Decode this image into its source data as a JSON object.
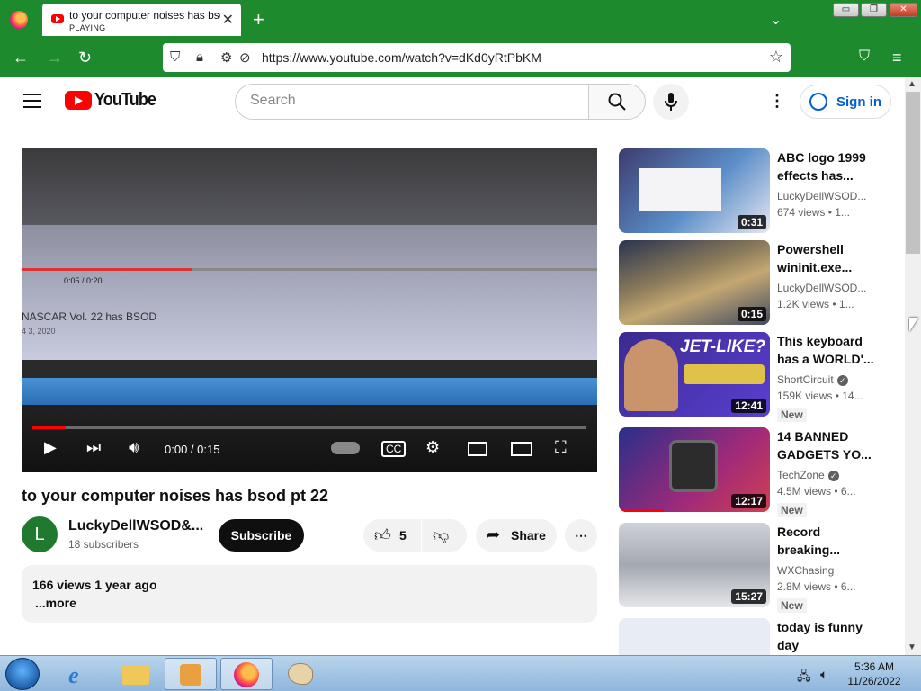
{
  "browser": {
    "tab": {
      "title": "to your computer noises has bsod pt 22",
      "status": "PLAYING"
    },
    "url": "https://www.youtube.com/watch?v=dKd0yRtPbKM"
  },
  "youtube": {
    "logo_text": "YouTube",
    "search_placeholder": "Search",
    "signin_label": "Sign in"
  },
  "player": {
    "time": "0:00 / 0:15",
    "progress": 0.06,
    "inner_title": "NASCAR Vol. 22 has BSOD",
    "inner_date": "4 3, 2020",
    "inner_time": "0:05 / 0:20"
  },
  "video": {
    "title": "to your computer noises has bsod pt 22",
    "channel_initial": "L",
    "channel": "LuckyDellWSOD&...",
    "subscribers": "18 subscribers",
    "subscribe_label": "Subscribe",
    "likes": "5",
    "share_label": "Share",
    "meta": "166 views  1 year ago",
    "more_label": "...more"
  },
  "recommendations": [
    {
      "title": "ABC logo 1999 effects has...",
      "channel": "LuckyDellWSOD...",
      "verified": false,
      "stats": "674 views  • 1...",
      "duration": "0:31",
      "badge": ""
    },
    {
      "title": "Powershell wininit.exe...",
      "channel": "LuckyDellWSOD...",
      "verified": false,
      "stats": "1.2K views  • 1...",
      "duration": "0:15",
      "badge": ""
    },
    {
      "title": "This keyboard has a WORLD'...",
      "channel": "ShortCircuit",
      "verified": true,
      "stats": "159K views  • 14...",
      "duration": "12:41",
      "badge": "New"
    },
    {
      "title": "14 BANNED GADGETS YO...",
      "channel": "TechZone",
      "verified": true,
      "stats": "4.5M views  • 6...",
      "duration": "12:17",
      "badge": "New"
    },
    {
      "title": "Record breaking...",
      "channel": "WXChasing",
      "verified": false,
      "stats": "2.8M views  • 6...",
      "duration": "15:27",
      "badge": "New"
    },
    {
      "title": "today is funny day",
      "channel": "",
      "verified": false,
      "stats": "",
      "duration": "",
      "badge": ""
    }
  ],
  "recommendation_thumb_texts": {
    "keyboard": "JET-LIKE?"
  },
  "taskbar": {
    "time": "5:36 AM",
    "date": "11/26/2022"
  },
  "colors": {
    "browser_green": "#1e8a2e",
    "youtube_red": "#ff0000",
    "link_blue": "#065fd4"
  }
}
